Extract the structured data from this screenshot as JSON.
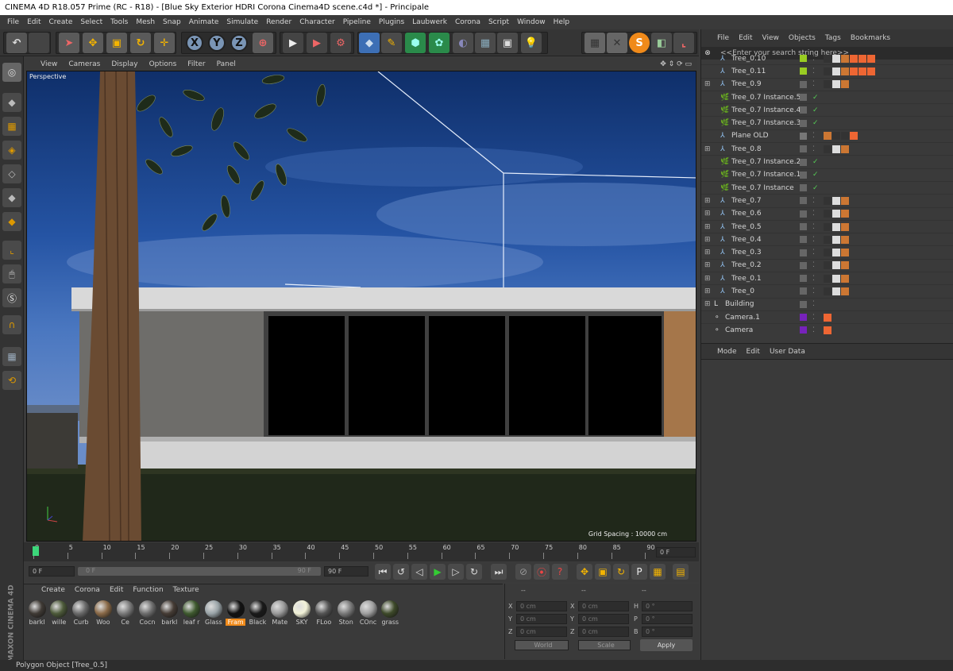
{
  "window": {
    "title": "CINEMA 4D R18.057 Prime (RC - R18) - [Blue Sky Exterior HDRI  Corona Cinema4D scene.c4d *] - Principale"
  },
  "menubar": [
    "File",
    "Edit",
    "Create",
    "Select",
    "Tools",
    "Mesh",
    "Snap",
    "Animate",
    "Simulate",
    "Render",
    "Character",
    "Pipeline",
    "Plugins",
    "Laubwerk",
    "Corona",
    "Script",
    "Window",
    "Help"
  ],
  "toolbar": {
    "axes": [
      "X",
      "Y",
      "Z"
    ]
  },
  "viewport": {
    "menu": [
      "View",
      "Cameras",
      "Display",
      "Options",
      "Filter",
      "Panel"
    ],
    "label": "Perspective",
    "grid_spacing": "Grid Spacing : 10000 cm"
  },
  "timeline": {
    "ticks": [
      "0",
      "5",
      "10",
      "15",
      "20",
      "25",
      "30",
      "35",
      "40",
      "45",
      "50",
      "55",
      "60",
      "65",
      "70",
      "75",
      "80",
      "85",
      "90"
    ],
    "frame_field": "0 F"
  },
  "transport": {
    "start": "0 F",
    "slider_left": "0 F",
    "slider_right": "90 F",
    "end": "90 F"
  },
  "materials": {
    "menu": [
      "Create",
      "Corona",
      "Edit",
      "Function",
      "Texture"
    ],
    "items": [
      "barkl",
      "wille",
      "Curb",
      "Woo",
      "Ce",
      "Cocn",
      "barkl",
      "leaf r",
      "Glass",
      "Fram",
      "Black",
      "Mate",
      "SKY",
      "FLoo",
      "Ston",
      "COnc",
      "grass"
    ]
  },
  "coords": {
    "headers": [
      "--",
      "--",
      "--"
    ],
    "rows": [
      [
        "X",
        "0 cm",
        "X",
        "0 cm",
        "H",
        "0 °"
      ],
      [
        "Y",
        "0 cm",
        "Y",
        "0 cm",
        "P",
        "0 °"
      ],
      [
        "Z",
        "0 cm",
        "Z",
        "0 cm",
        "B",
        "0 °"
      ]
    ],
    "mode": "World",
    "scale": "Scale",
    "apply": "Apply"
  },
  "status": {
    "text": "Polygon Object [Tree_0.5]"
  },
  "objects": {
    "menu": [
      "File",
      "Edit",
      "View",
      "Objects",
      "Tags",
      "Bookmarks"
    ],
    "search": "<<Enter your search string here>>",
    "rows": [
      "Tree_0.10",
      "Tree_0.11",
      "Tree_0.9",
      "Tree_0.7 Instance.5",
      "Tree_0.7 Instance.4",
      "Tree_0.7 Instance.3",
      "Plane OLD",
      "Tree_0.8",
      "Tree_0.7 Instance.2",
      "Tree_0.7 Instance.1",
      "Tree_0.7 Instance",
      "Tree_0.7",
      "Tree_0.6",
      "Tree_0.5",
      "Tree_0.4",
      "Tree_0.3",
      "Tree_0.2",
      "Tree_0.1",
      "Tree_0",
      "Building",
      "Camera.1",
      "Camera"
    ]
  },
  "attributes": {
    "menu": [
      "Mode",
      "Edit",
      "User Data"
    ]
  },
  "brand": "MAXON CINEMA 4D"
}
